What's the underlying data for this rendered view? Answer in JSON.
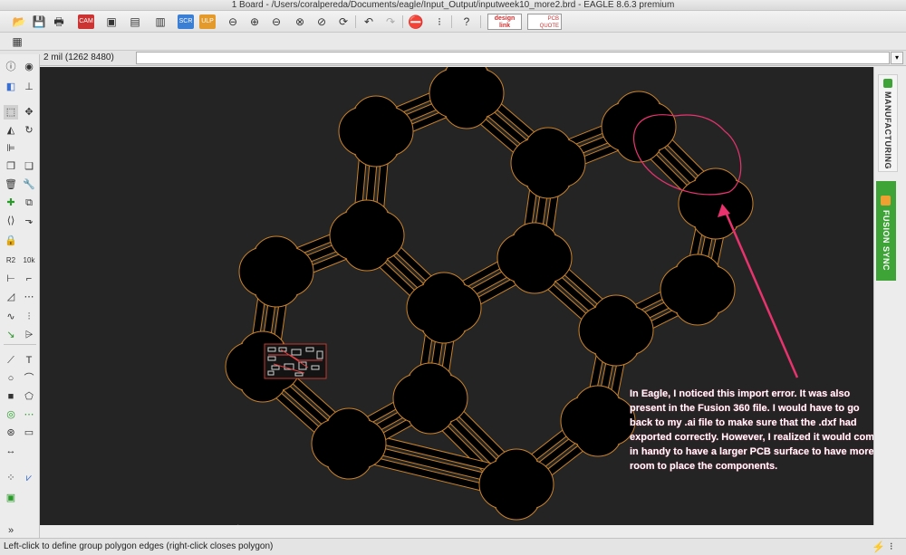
{
  "window": {
    "title": "1 Board - /Users/coralpereda/Documents/eagle/Input_Output/inputweek10_more2.brd - EAGLE 8.6.3 premium"
  },
  "toolbar": {
    "buttons": [
      "open-icon",
      "save-icon",
      "print-icon",
      "cam-icon",
      "layers-icon",
      "board-icon",
      "schematic-icon",
      "script-icon",
      "ulp-icon",
      "zoom-fit-icon",
      "zoom-in-icon",
      "zoom-out-icon",
      "zoom-select-icon",
      "zoom-last-icon",
      "redraw-icon",
      "undo-icon",
      "redo-icon",
      "stop-icon",
      "go-icon",
      "help-icon"
    ],
    "design_link": "design link",
    "pcb_quote": "PCB QUOTE"
  },
  "command": {
    "coordinate": "2 mil (1262 8480)",
    "input_value": "",
    "input_placeholder": ""
  },
  "right_panel": {
    "manufacturing_label": "MANUFACTURING",
    "fusion_label": "FUSION SYNC"
  },
  "annotation": {
    "text": "In Eagle, I noticed this import error. It was also present in the Fusion 360 file. I would have to go back to my .ai file to make sure that the .dxf had exported correctly. However, I realized it would come in handy to have  a larger PCB surface to have more room to place the components."
  },
  "status": {
    "text": "Left-click to define group polygon edges (right-click closes polygon)"
  },
  "colors": {
    "canvas_bg": "#242424",
    "outline": "#c9822a",
    "annotation": "#e8336f",
    "fusion_green": "#3fa438"
  }
}
